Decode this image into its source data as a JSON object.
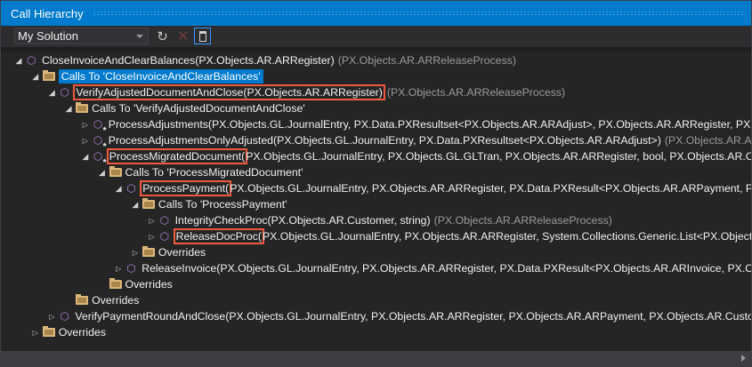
{
  "window": {
    "title": "Call Hierarchy"
  },
  "toolbar": {
    "scope": "My Solution",
    "refresh": "refresh-icon",
    "stop": "cancel-icon",
    "pin": "toggle-details-pane-icon"
  },
  "tree": [
    {
      "level": 0,
      "kind": "method",
      "expanded": true,
      "name": "CloseInvoiceAndClearBalances(PX.Objects.AR.ARRegister)",
      "rest": "",
      "container": "(PX.Objects.AR.ARReleaseProcess)"
    },
    {
      "level": 1,
      "kind": "folder",
      "expanded": true,
      "selected": true,
      "name": "Calls To 'CloseInvoiceAndClearBalances'"
    },
    {
      "level": 2,
      "kind": "method",
      "expanded": true,
      "highlight": "VerifyAdjustedDocumentAndClose(PX.Objects.AR.ARRegister)",
      "rest": "",
      "container": "(PX.Objects.AR.ARReleaseProcess)"
    },
    {
      "level": 3,
      "kind": "folder",
      "expanded": true,
      "name": "Calls To 'VerifyAdjustedDocumentAndClose'"
    },
    {
      "level": 4,
      "kind": "method-star",
      "expanded": false,
      "name": "ProcessAdjustments(PX.Objects.GL.JournalEntry, PX.Data.PXResultset<PX.Objects.AR.ARAdjust>, PX.Objects.AR.ARRegister, PX.Objects..",
      "container": ""
    },
    {
      "level": 4,
      "kind": "method-star",
      "expanded": false,
      "name": "ProcessAdjustmentsOnlyAdjusted(PX.Objects.GL.JournalEntry, PX.Data.PXResultset<PX.Objects.AR.ARAdjust>)",
      "container": "(PX.Objects.AR.ARReleas"
    },
    {
      "level": 4,
      "kind": "method-star",
      "expanded": true,
      "highlight": "ProcessMigratedDocument(",
      "rest": "PX.Objects.GL.JournalEntry, PX.Objects.GL.GLTran, PX.Objects.AR.ARRegister, bool, PX.Objects.AR.Customer",
      "container": ""
    },
    {
      "level": 5,
      "kind": "folder",
      "expanded": true,
      "name": "Calls To 'ProcessMigratedDocument'"
    },
    {
      "level": 6,
      "kind": "method",
      "expanded": true,
      "highlight": "ProcessPayment(",
      "rest": "PX.Objects.GL.JournalEntry, PX.Objects.AR.ARRegister, PX.Data.PXResult<PX.Objects.AR.ARPayment, PX.Object",
      "container": ""
    },
    {
      "level": 7,
      "kind": "folder",
      "expanded": true,
      "name": "Calls To 'ProcessPayment'"
    },
    {
      "level": 8,
      "kind": "method",
      "expanded": false,
      "name": "IntegrityCheckProc(PX.Objects.AR.Customer, string)",
      "container": "(PX.Objects.AR.ARReleaseProcess)"
    },
    {
      "level": 8,
      "kind": "method",
      "expanded": false,
      "highlight": "ReleaseDocProc(",
      "rest": "PX.Objects.GL.JournalEntry, PX.Objects.AR.ARRegister, System.Collections.Generic.List<PX.Objects.GL.Ba",
      "container": ""
    },
    {
      "level": 7,
      "kind": "folder",
      "expanded": false,
      "name": "Overrides"
    },
    {
      "level": 6,
      "kind": "method",
      "expanded": false,
      "name": "ReleaseInvoice(PX.Objects.GL.JournalEntry, PX.Objects.AR.ARRegister, PX.Data.PXResult<PX.Objects.AR.ARInvoice, PX.Objects.CM",
      "container": ""
    },
    {
      "level": 5,
      "kind": "folder",
      "noexpander": true,
      "name": "Overrides"
    },
    {
      "level": 3,
      "kind": "folder",
      "noexpander": true,
      "name": "Overrides"
    },
    {
      "level": 2,
      "kind": "method",
      "expanded": false,
      "name": "VerifyPaymentRoundAndClose(PX.Objects.GL.JournalEntry, PX.Objects.AR.ARRegister, PX.Objects.AR.ARPayment, PX.Objects.AR.Customer, PX.",
      "container": ""
    },
    {
      "level": 1,
      "kind": "folder",
      "expanded": false,
      "name": "Overrides"
    }
  ]
}
